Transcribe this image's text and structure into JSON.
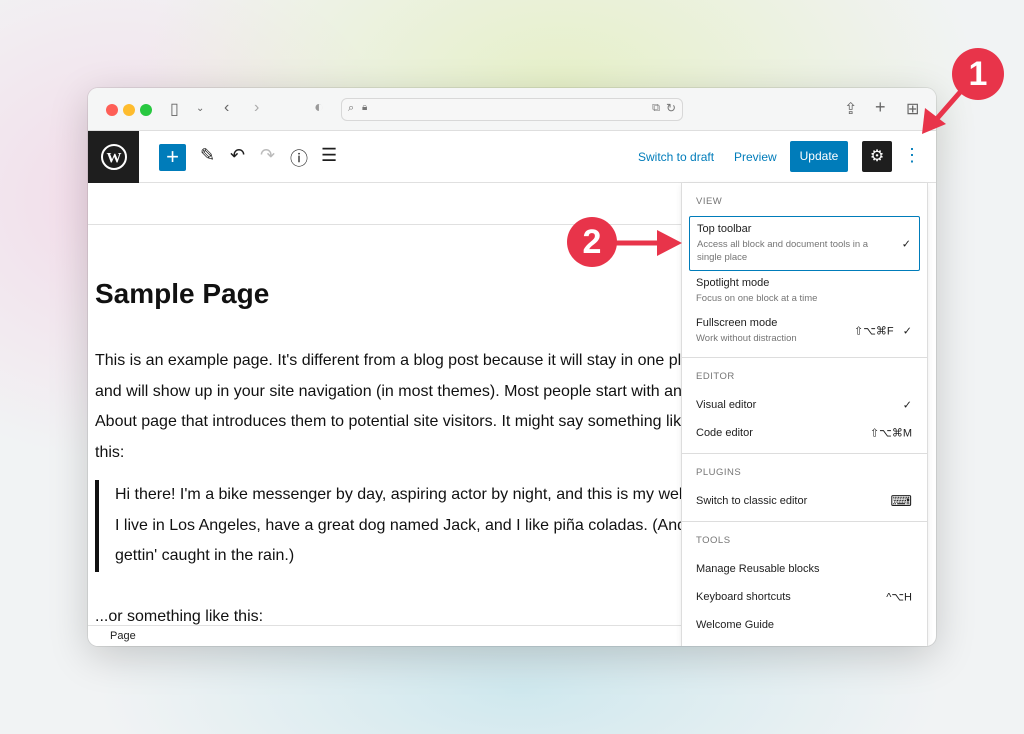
{
  "toolbar": {
    "switch_to_draft": "Switch to draft",
    "preview": "Preview",
    "update": "Update"
  },
  "content": {
    "title": "Sample Page",
    "paragraph": [
      "This is an example page. It's different from a blog post because it will stay in one place",
      "and will show up in your site navigation (in most themes). Most people start with an",
      "About page that introduces them to potential site visitors. It might say something like",
      "this:"
    ],
    "quote": [
      "Hi there! I'm a bike messenger by day, aspiring actor by night, and this is my website.",
      "I live in Los Angeles, have a great dog named Jack, and I like piña coladas. (And",
      "gettin' caught in the rain.)"
    ],
    "after": "...or something like this:"
  },
  "footer": {
    "breadcrumb": "Page"
  },
  "menu": {
    "view": {
      "heading": "VIEW",
      "items": [
        {
          "label": "Top toolbar",
          "desc": "Access all block and document tools in a single place",
          "right": "✓"
        },
        {
          "label": "Spotlight mode",
          "desc": "Focus on one block at a time",
          "right": ""
        },
        {
          "label": "Fullscreen mode",
          "desc": "Work without distraction",
          "right": "⇧⌥⌘F   ✓"
        }
      ]
    },
    "editor": {
      "heading": "EDITOR",
      "items": [
        {
          "label": "Visual editor",
          "right": "✓"
        },
        {
          "label": "Code editor",
          "right": "⇧⌥⌘M"
        }
      ]
    },
    "plugins": {
      "heading": "PLUGINS",
      "items": [
        {
          "label": "Switch to classic editor",
          "right": "⌨"
        }
      ]
    },
    "tools": {
      "heading": "TOOLS",
      "items": [
        {
          "label": "Manage Reusable blocks",
          "right": ""
        },
        {
          "label": "Keyboard shortcuts",
          "right": "^⌥H"
        },
        {
          "label": "Welcome Guide",
          "right": ""
        }
      ]
    }
  },
  "annotations": {
    "one": "1",
    "two": "2"
  },
  "colors": {
    "accent": "#007cba",
    "annotation": "#e8344a"
  }
}
